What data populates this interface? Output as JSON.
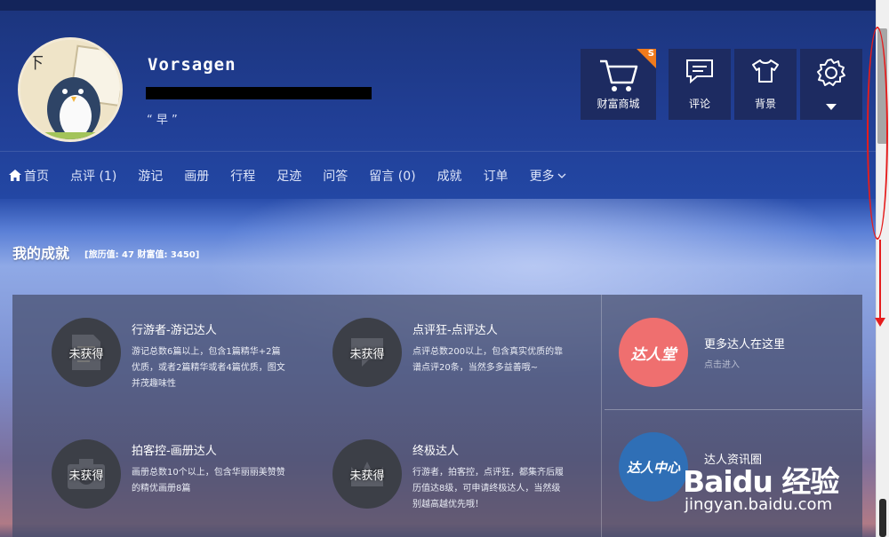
{
  "profile": {
    "username": "Vorsagen",
    "motto": "“ 早 ”"
  },
  "toolbar": {
    "shop_label": "财富商城",
    "shop_badge": "S",
    "comment_label": "评论",
    "background_label": "背景"
  },
  "nav": {
    "items": [
      {
        "label": "首页"
      },
      {
        "label": "点评 (1)"
      },
      {
        "label": "游记"
      },
      {
        "label": "画册"
      },
      {
        "label": "行程"
      },
      {
        "label": "足迹"
      },
      {
        "label": "问答"
      },
      {
        "label": "留言 (0)"
      },
      {
        "label": "成就"
      },
      {
        "label": "订单"
      },
      {
        "label": "更多"
      }
    ]
  },
  "achievements": {
    "title": "我的成就",
    "stats": "[旅历值: 47  财富值: 3450]",
    "items": [
      {
        "badge": "未获得",
        "title": "行游者-游记达人",
        "desc": "游记总数6篇以上，包含1篇精华+2篇优质，或者2篇精华或者4篇优质，图文并茂趣味性",
        "icon": "document-icon"
      },
      {
        "badge": "未获得",
        "title": "点评狂-点评达人",
        "desc": "点评总数200以上，包含真实优质的靠谱点评20条，当然多多益善哦~",
        "icon": "speech-bubble-icon"
      },
      {
        "badge": "未获得",
        "title": "拍客控-画册达人",
        "desc": "画册总数10个以上，包含华丽丽美赞赞的精优画册8篇",
        "icon": "camera-icon"
      },
      {
        "badge": "未获得",
        "title": "终极达人",
        "desc": "行游者，拍客控，点评狂，都集齐后履历值达8级，可申请终极达人，当然级别越高越优先哦！",
        "icon": "crown-icon"
      }
    ]
  },
  "side": {
    "more_badge": "达人堂",
    "more_title": "更多达人在这里",
    "more_sub": "点击进入",
    "center_badge": "达人中心",
    "center_title": "达人资讯圈",
    "accent_red": "#ef6f6f",
    "accent_blue": "#2f6fb6"
  },
  "watermark": {
    "logo": "Baidu 经验",
    "url": "jingyan.baidu.com"
  }
}
